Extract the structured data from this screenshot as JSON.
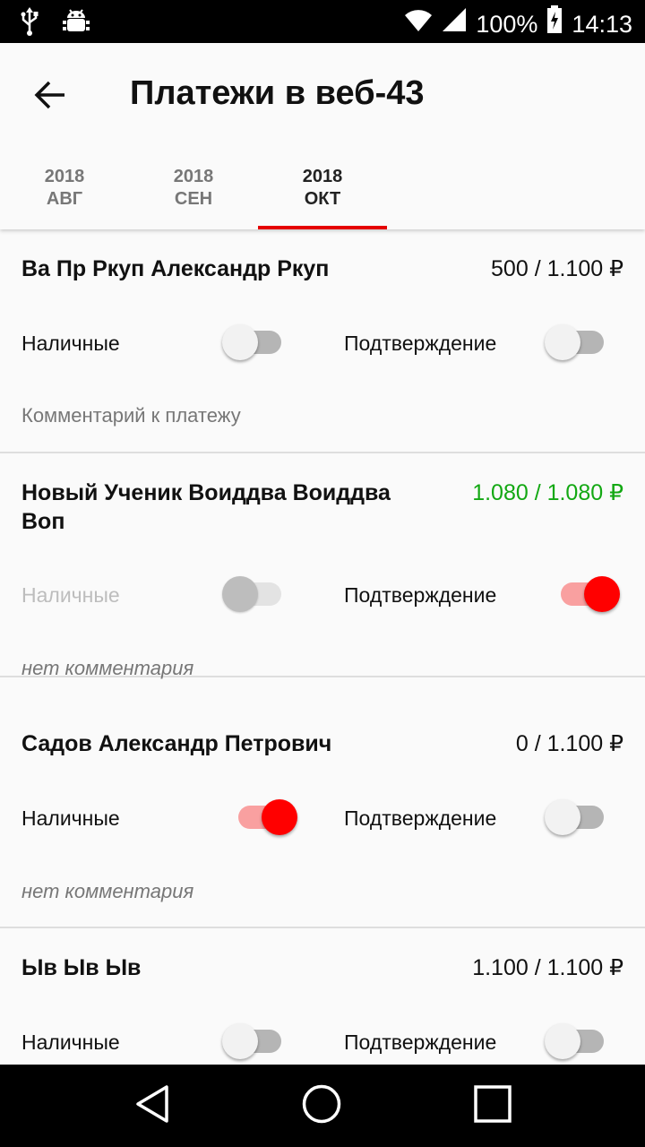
{
  "status_bar": {
    "battery": "100%",
    "time": "14:13",
    "icons": [
      "usb-icon",
      "android-debug-icon",
      "wifi-icon",
      "signal-icon",
      "battery-charging-icon"
    ]
  },
  "app_bar": {
    "title": "Платежи в веб-43",
    "back_icon": "arrow-back-icon"
  },
  "tabs": [
    {
      "year": "2018",
      "month": "АВГ",
      "active": false
    },
    {
      "year": "2018",
      "month": "СЕН",
      "active": false
    },
    {
      "year": "2018",
      "month": "ОКТ",
      "active": true
    }
  ],
  "colors": {
    "accent": "#e50000",
    "paid_amount": "#13a813",
    "switch_on": "#ff0000"
  },
  "payments": [
    {
      "name": "Ва Пр Ркуп Александр Ркуп",
      "amount": "500 / 1.100 ₽",
      "cash_label": "Наличные",
      "confirm_label": "Подтверждение",
      "cash_on": false,
      "cash_disabled": false,
      "confirm_on": false,
      "comment": "Комментарий к платежу"
    },
    {
      "name": "Новый Ученик Воиддва Воиддва Воп",
      "amount": "1.080 / 1.080 ₽",
      "cash_label": "Наличные",
      "confirm_label": "Подтверждение",
      "cash_on": false,
      "cash_disabled": true,
      "confirm_on": true,
      "comment": "нет комментария"
    },
    {
      "name": "Садов Александр Петрович",
      "amount": "0 / 1.100 ₽",
      "cash_label": "Наличные",
      "confirm_label": "Подтверждение",
      "cash_on": true,
      "cash_disabled": false,
      "confirm_on": false,
      "comment": "нет комментария"
    },
    {
      "name": "Ыв Ыв Ыв",
      "amount": "1.100 / 1.100 ₽",
      "cash_label": "Наличные",
      "confirm_label": "Подтверждение",
      "cash_on": false,
      "cash_disabled": false,
      "confirm_on": false,
      "comment": ""
    }
  ],
  "nav_bar": {
    "icons": [
      "back-triangle-icon",
      "home-circle-icon",
      "recents-square-icon"
    ]
  }
}
